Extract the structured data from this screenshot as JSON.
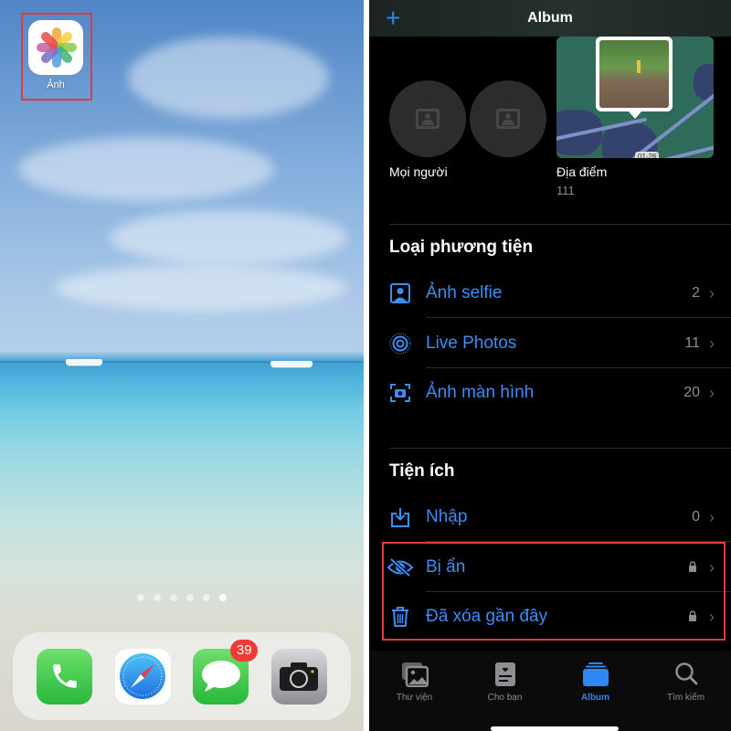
{
  "home_screen": {
    "apps": [
      {
        "name": "photos",
        "label": "Ảnh",
        "icon": "photos-flower-icon",
        "highlighted": true
      }
    ],
    "page_dots": {
      "count": 6,
      "active_index": 5
    },
    "dock": [
      {
        "name": "phone",
        "icon": "phone-handset-icon"
      },
      {
        "name": "safari",
        "icon": "compass-icon"
      },
      {
        "name": "messages",
        "icon": "speech-bubble-icon",
        "badge": "39"
      },
      {
        "name": "camera",
        "icon": "camera-icon"
      }
    ]
  },
  "photos_app": {
    "navbar": {
      "title": "Album",
      "add_icon": "plus-icon"
    },
    "albums": [
      {
        "label": "Mọi người",
        "count": ""
      },
      {
        "label": "Địa điểm",
        "count": "111",
        "map_chip": "01-26"
      }
    ],
    "media_types": {
      "title": "Loại phương tiện",
      "items": [
        {
          "label": "Ảnh selfie",
          "count": "2",
          "icon": "selfie-portrait-icon"
        },
        {
          "label": "Live Photos",
          "count": "11",
          "icon": "live-photo-icon"
        },
        {
          "label": "Ảnh màn hình",
          "count": "20",
          "icon": "screenshot-icon"
        }
      ]
    },
    "utilities": {
      "title": "Tiện ích",
      "items": [
        {
          "label": "Nhập",
          "count": "0",
          "icon": "import-tray-icon",
          "locked": false
        },
        {
          "label": "Bị ẩn",
          "count": "",
          "icon": "eye-slash-icon",
          "locked": true,
          "highlighted": true
        },
        {
          "label": "Đã xóa gần đây",
          "count": "",
          "icon": "trash-icon",
          "locked": true,
          "highlighted": true
        }
      ]
    },
    "tabbar": {
      "tabs": [
        {
          "label": "Thư viện",
          "icon": "photo-library-icon",
          "active": false
        },
        {
          "label": "Cho bạn",
          "icon": "for-you-card-icon",
          "active": false
        },
        {
          "label": "Album",
          "icon": "albums-stack-icon",
          "active": true
        },
        {
          "label": "Tìm kiếm",
          "icon": "search-icon",
          "active": false
        }
      ]
    },
    "colors": {
      "accent": "#2f87f5",
      "highlight_box": "#e0393e",
      "background": "#000000",
      "secondary_text": "#8e8e93"
    }
  }
}
